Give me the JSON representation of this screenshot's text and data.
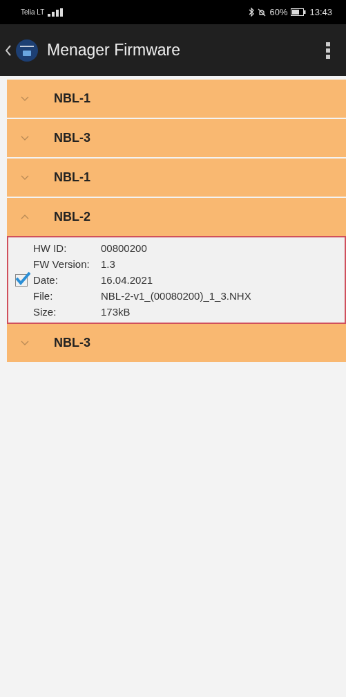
{
  "status_bar": {
    "carrier": "Telia LT",
    "battery": "60%",
    "time": "13:43"
  },
  "app_bar": {
    "title": "Menager Firmware"
  },
  "groups": [
    {
      "title": "NBL-1",
      "expanded": false
    },
    {
      "title": "NBL-3",
      "expanded": false
    },
    {
      "title": "NBL-1",
      "expanded": false
    },
    {
      "title": "NBL-2",
      "expanded": true,
      "item": {
        "checked": true,
        "fields": [
          {
            "label": "HW ID:",
            "value": "00800200"
          },
          {
            "label": "FW Version:",
            "value": "1.3"
          },
          {
            "label": "Date:",
            "value": "16.04.2021"
          },
          {
            "label": "File:",
            "value": "NBL-2-v1_(00080200)_1_3.NHX"
          },
          {
            "label": "Size:",
            "value": "173kB"
          }
        ]
      }
    },
    {
      "title": "NBL-3",
      "expanded": false
    }
  ]
}
